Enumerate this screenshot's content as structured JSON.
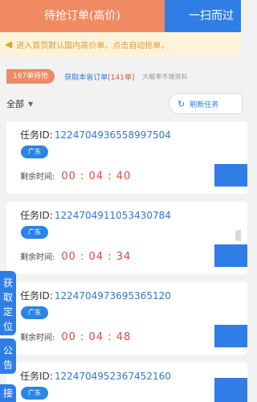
{
  "tabs": {
    "grab_orders": "待抢订单(高价)",
    "scan": "一扫而过"
  },
  "notice": {
    "icon": "megaphone-icon",
    "text": "进入首页默认国内高价单，点击自动抢单，"
  },
  "stats": {
    "pending": "167单待抢",
    "fetch_prefix": "获取本省订单",
    "fetch_count": "[141单]",
    "hint": "大概率不填资料"
  },
  "filter": {
    "selected": "全部",
    "refresh_label": "刷新任务"
  },
  "tasks": [
    {
      "id_label": "任务ID:",
      "id": "1224704936558997504",
      "region": "广东",
      "time_label": "剩余时间:",
      "remaining": "00 : 04 : 40"
    },
    {
      "id_label": "任务ID:",
      "id": "1224704911053430784",
      "region": "广东",
      "time_label": "剩余时间:",
      "remaining": "00 : 04 : 34"
    },
    {
      "id_label": "任务ID:",
      "id": "1224704973695365120",
      "region": "广东",
      "time_label": "剩余时间:",
      "remaining": "00 : 04 : 48"
    },
    {
      "id_label": "任务ID:",
      "id": "1224704952367452160",
      "region": "广东"
    }
  ],
  "side": {
    "fetch_location": "获取定位",
    "announcement": "公告",
    "partial": "接"
  },
  "colors": {
    "accent_orange": "#ef8a63",
    "brand_blue": "#2f7ee6",
    "countdown_red": "#e2483d"
  }
}
